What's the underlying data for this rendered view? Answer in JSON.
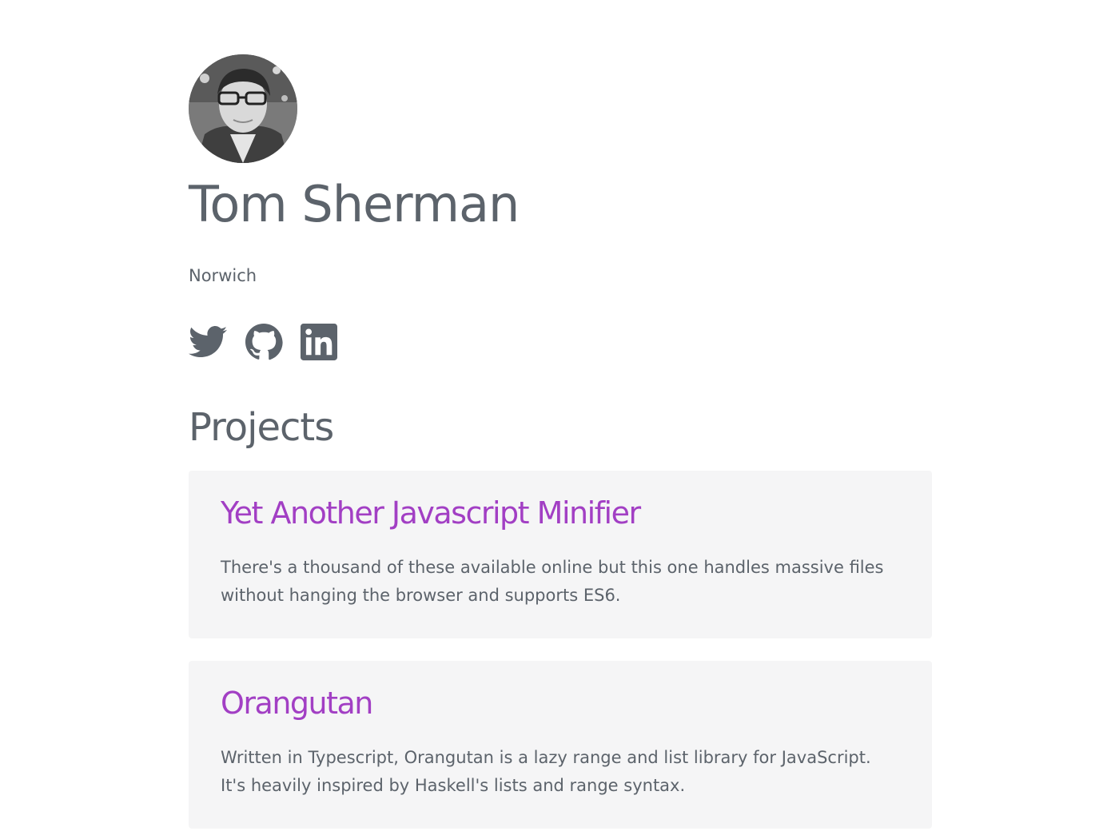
{
  "profile": {
    "name": "Tom Sherman",
    "location": "Norwich",
    "avatar_icon": "profile-photo"
  },
  "socials": [
    {
      "name": "twitter",
      "icon": "twitter-icon"
    },
    {
      "name": "github",
      "icon": "github-icon"
    },
    {
      "name": "linkedin",
      "icon": "linkedin-icon"
    }
  ],
  "projects_section": {
    "title": "Projects",
    "items": [
      {
        "title": "Yet Another Javascript Minifier",
        "description": "There's a thousand of these available online but this one handles massive files without hanging the browser and supports ES6."
      },
      {
        "title": "Orangutan",
        "description": "Written in Typescript, Orangutan is a lazy range and list library for JavaScript. It's heavily inspired by Haskell's lists and range syntax."
      }
    ]
  },
  "colors": {
    "text": "#5c636b",
    "link": "#a23fc4",
    "card_bg": "#f5f5f6",
    "background": "#ffffff"
  }
}
